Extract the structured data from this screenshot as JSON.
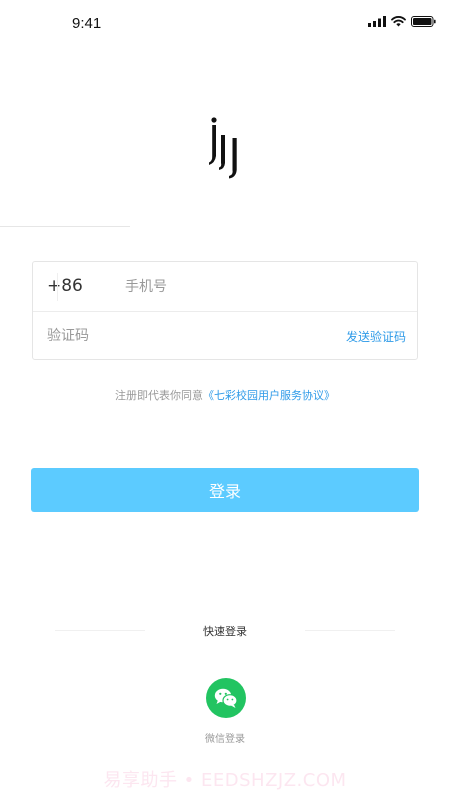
{
  "status_bar": {
    "time": "9:41",
    "icons": [
      "signal-icon",
      "wifi-icon",
      "battery-icon"
    ]
  },
  "logo": {
    "icon": "brand-logo-icon"
  },
  "login_form": {
    "country_code": "+86",
    "phone_placeholder": "手机号",
    "phone_value": "",
    "code_placeholder": "验证码",
    "code_value": "",
    "send_code_label": "发送验证码"
  },
  "agreement": {
    "prefix": "注册即代表你同意",
    "link": "《七彩校园用户服务协议》"
  },
  "login_button": {
    "label": "登录"
  },
  "quick_login": {
    "title": "快速登录",
    "wechat_label": "微信登录",
    "wechat_icon": "wechat-icon"
  },
  "watermark": "易享助手 • EEDSHZJZ.COM",
  "colors": {
    "accent": "#2f9be8",
    "login_button": "#5ccbff",
    "wechat": "#22c461"
  }
}
